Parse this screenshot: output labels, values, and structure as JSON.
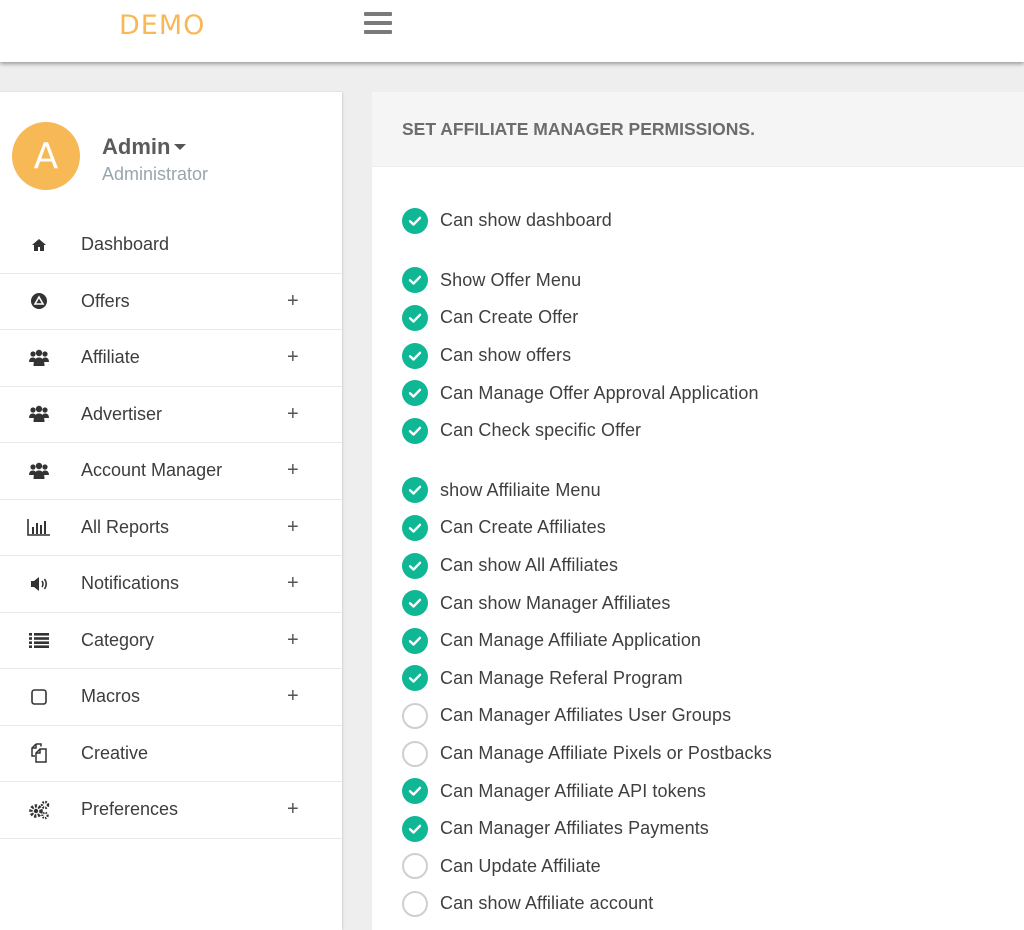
{
  "brand": "DEMO",
  "user": {
    "initial": "A",
    "name": "Admin",
    "role": "Administrator"
  },
  "sidebar": {
    "items": [
      {
        "label": "Dashboard",
        "icon": "home-icon",
        "expandable": false
      },
      {
        "label": "Offers",
        "icon": "offers-icon",
        "expandable": true
      },
      {
        "label": "Affiliate",
        "icon": "users-icon",
        "expandable": true
      },
      {
        "label": "Advertiser",
        "icon": "users-icon",
        "expandable": true
      },
      {
        "label": "Account Manager",
        "icon": "users-icon",
        "expandable": true
      },
      {
        "label": "All Reports",
        "icon": "bar-chart-icon",
        "expandable": true
      },
      {
        "label": "Notifications",
        "icon": "speaker-icon",
        "expandable": true
      },
      {
        "label": "Category",
        "icon": "list-icon",
        "expandable": true
      },
      {
        "label": "Macros",
        "icon": "square-icon",
        "expandable": true
      },
      {
        "label": "Creative",
        "icon": "copy-icon",
        "expandable": false
      },
      {
        "label": "Preferences",
        "icon": "gears-icon",
        "expandable": true
      }
    ],
    "plus_symbol": "+"
  },
  "panel": {
    "title": "SET AFFILIATE MANAGER PERMISSIONS.",
    "groups": [
      [
        {
          "label": "Can show dashboard",
          "checked": true
        }
      ],
      [
        {
          "label": "Show Offer Menu",
          "checked": true
        },
        {
          "label": "Can Create Offer",
          "checked": true
        },
        {
          "label": "Can show offers",
          "checked": true
        },
        {
          "label": "Can Manage Offer Approval Application",
          "checked": true
        },
        {
          "label": "Can Check specific Offer",
          "checked": true
        }
      ],
      [
        {
          "label": "show Affiliaite Menu",
          "checked": true
        },
        {
          "label": "Can Create Affiliates",
          "checked": true
        },
        {
          "label": "Can show All Affiliates",
          "checked": true
        },
        {
          "label": "Can show Manager Affiliates",
          "checked": true
        },
        {
          "label": "Can Manage Affiliate Application",
          "checked": true
        },
        {
          "label": "Can Manage Referal Program",
          "checked": true
        },
        {
          "label": "Can Manager Affiliates User Groups",
          "checked": false
        },
        {
          "label": "Can Manage Affiliate Pixels or Postbacks",
          "checked": false
        },
        {
          "label": "Can Manager Affiliate API tokens",
          "checked": true
        },
        {
          "label": "Can Manager Affiliates Payments",
          "checked": true
        },
        {
          "label": "Can Update Affiliate",
          "checked": false
        },
        {
          "label": "Can show Affiliate account",
          "checked": false
        }
      ]
    ]
  },
  "colors": {
    "brand": "#f7b955",
    "check": "#10b794",
    "muted": "#98a6ad"
  }
}
